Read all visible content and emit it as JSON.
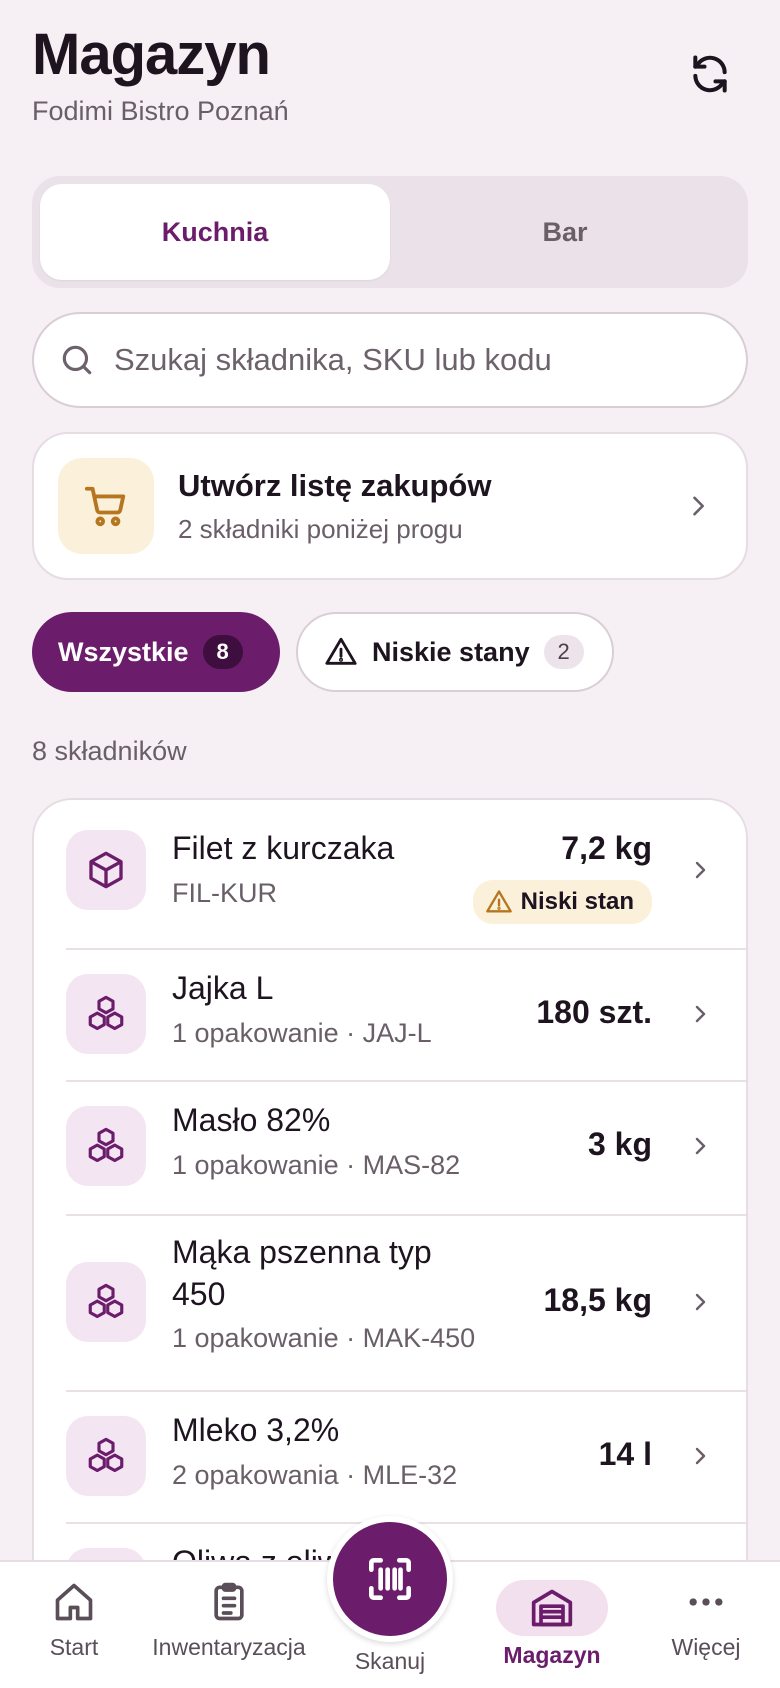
{
  "header": {
    "title": "Magazyn",
    "subtitle": "Fodimi Bistro Poznań"
  },
  "tabs": [
    {
      "label": "Kuchnia",
      "active": true
    },
    {
      "label": "Bar",
      "active": false
    }
  ],
  "search": {
    "placeholder": "Szukaj składnika, SKU lub kodu"
  },
  "shopping_card": {
    "title": "Utwórz listę zakupów",
    "subtitle": "2 składniki poniżej progu"
  },
  "filters": [
    {
      "label": "Wszystkie",
      "count": "8",
      "active": true
    },
    {
      "label": "Niskie stany",
      "count": "2",
      "active": false
    }
  ],
  "count_label": "8 składników",
  "items": [
    {
      "name": "Filet z kurczaka",
      "meta": "FIL-KUR",
      "qty": "7,2 kg",
      "badge": "Niski stan"
    },
    {
      "name": "Jajka L",
      "meta": "1 opakowanie · JAJ-L",
      "qty": "180 szt."
    },
    {
      "name": "Masło 82%",
      "meta": "1 opakowanie · MAS-82",
      "qty": "3 kg"
    },
    {
      "name_line1": "Mąka pszenna typ",
      "name_line2": "450",
      "meta": "1 opakowanie · MAK-450",
      "qty": "18,5 kg"
    },
    {
      "name": "Mleko 3,2%",
      "meta": "2 opakowania · MLE-32",
      "qty": "14 l"
    },
    {
      "name": "Oliwa z oliwek",
      "meta": "",
      "qty": ""
    }
  ],
  "nav": {
    "start": "Start",
    "inventory": "Inwentaryzacja",
    "scan": "Skanuj",
    "warehouse": "Magazyn",
    "more": "Więcej"
  },
  "colors": {
    "accent": "#6b1d6b",
    "warning_bg": "#fbf0da",
    "warning": "#b5761f",
    "background": "#f6f0f4"
  }
}
